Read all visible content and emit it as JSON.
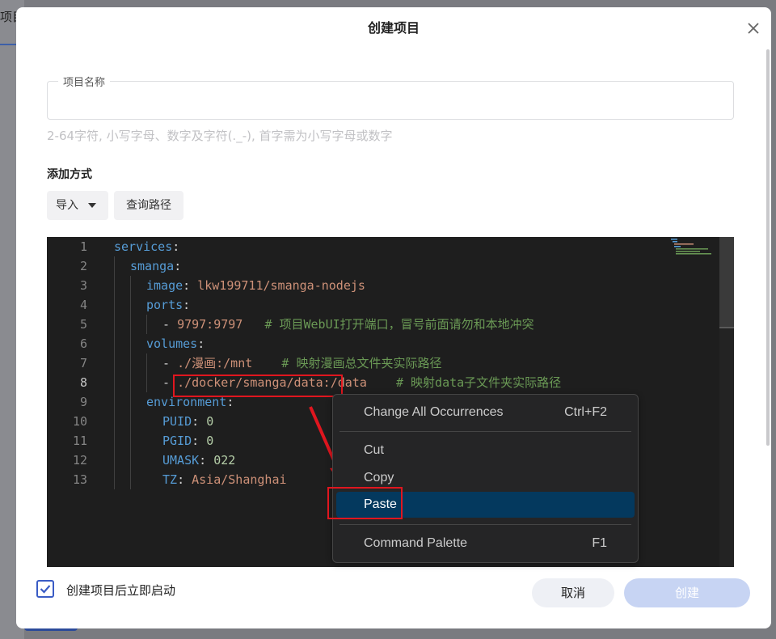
{
  "background": {
    "tab_label": "项目"
  },
  "dialog": {
    "title": "创建项目",
    "name_field": {
      "label": "项目名称",
      "value": "",
      "hint": "2-64字符, 小写字母、数字及字符(._-), 首字需为小写字母或数字"
    },
    "add_method": {
      "label": "添加方式",
      "import_label": "导入",
      "query_path_label": "查询路径"
    },
    "editor": {
      "active_line": 8,
      "lines": [
        {
          "num": "1"
        },
        {
          "num": "2"
        },
        {
          "num": "3"
        },
        {
          "num": "4"
        },
        {
          "num": "5"
        },
        {
          "num": "6"
        },
        {
          "num": "7"
        },
        {
          "num": "8"
        },
        {
          "num": "9"
        },
        {
          "num": "10"
        },
        {
          "num": "11"
        },
        {
          "num": "12"
        },
        {
          "num": "13"
        }
      ],
      "tokens": {
        "l1_key": "services",
        "l1_colon": ":",
        "l2_key": "smanga",
        "l2_colon": ":",
        "l3_key": "image",
        "l3_colon": ": ",
        "l3_val": "lkw199711/smanga-nodejs",
        "l4_key": "ports",
        "l4_colon": ":",
        "l5_dash": "- ",
        "l5_val": "9797:9797",
        "l5_comment": "# 项目WebUI打开端口，冒号前面请勿和本地冲突",
        "l6_key": "volumes",
        "l6_colon": ":",
        "l7_dash": "- ",
        "l7_val": "./漫画:/mnt",
        "l7_comment": "# 映射漫画总文件夹实际路径",
        "l8_dash": "- ",
        "l8_val": "./docker/smanga/data:/data",
        "l8_comment": "# 映射data子文件夹实际路径",
        "l9_key": "environment",
        "l9_colon": ":",
        "l10_key": "PUID",
        "l10_colon": ": ",
        "l10_val": "0",
        "l11_key": "PGID",
        "l11_colon": ": ",
        "l11_val": "0",
        "l12_key": "UMASK",
        "l12_colon": ": ",
        "l12_val": "022",
        "l13_key": "TZ",
        "l13_colon": ": ",
        "l13_val": "Asia/Shanghai"
      }
    },
    "context_menu": {
      "items": [
        {
          "label": "Change All Occurrences",
          "shortcut": "Ctrl+F2"
        },
        {
          "label": "Cut",
          "shortcut": ""
        },
        {
          "label": "Copy",
          "shortcut": ""
        },
        {
          "label": "Paste",
          "shortcut": ""
        },
        {
          "label": "Command Palette",
          "shortcut": "F1"
        }
      ],
      "selected": "Paste"
    },
    "footer": {
      "auto_start_label": "创建项目后立即启动",
      "auto_start_checked": true,
      "cancel_label": "取消",
      "create_label": "创建"
    }
  },
  "colors": {
    "accent": "#3a5cc5",
    "annotation_red": "#e0161f",
    "menu_selected": "#04395e"
  }
}
